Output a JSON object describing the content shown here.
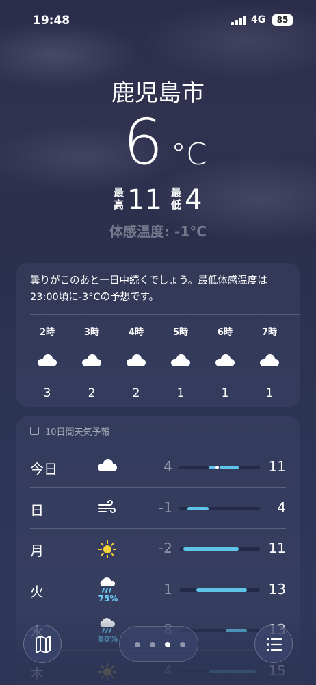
{
  "status": {
    "time": "19:48",
    "network": "4G",
    "battery": "85"
  },
  "location": {
    "city": "鹿児島市"
  },
  "current": {
    "temp": "6",
    "unit": "°C",
    "high_label": "最高",
    "high": "11",
    "low_label": "最低",
    "low": "4",
    "feels_like": "体感温度: -1°C"
  },
  "summary": "曇りがこのあと一日中続くでしょう。最低体感温度は23:00頃に-3°Cの予想です。",
  "hourly": [
    {
      "label": "2時",
      "icon": "cloud-icon",
      "value": "3"
    },
    {
      "label": "3時",
      "icon": "cloud-icon",
      "value": "2"
    },
    {
      "label": "4時",
      "icon": "cloud-icon",
      "value": "2"
    },
    {
      "label": "5時",
      "icon": "cloud-icon",
      "value": "1"
    },
    {
      "label": "6時",
      "icon": "cloud-icon",
      "value": "1"
    },
    {
      "label": "7時",
      "icon": "cloud-icon",
      "value": "1"
    }
  ],
  "forecast": {
    "title": "10日間天気予報",
    "range": {
      "min": -3,
      "max": 16
    },
    "current_temp": 6,
    "days": [
      {
        "day": "今日",
        "icon": "cloud-icon",
        "precip": "",
        "low": "4",
        "high": "11",
        "low_val": 4,
        "high_val": 11
      },
      {
        "day": "日",
        "icon": "wind-icon",
        "precip": "",
        "low": "-1",
        "high": "4",
        "low_val": -1,
        "high_val": 4
      },
      {
        "day": "月",
        "icon": "sun-icon",
        "precip": "",
        "low": "-2",
        "high": "11",
        "low_val": -2,
        "high_val": 11
      },
      {
        "day": "火",
        "icon": "rain-cloud-icon",
        "precip": "75%",
        "low": "1",
        "high": "13",
        "low_val": 1,
        "high_val": 13
      },
      {
        "day": "水",
        "icon": "rain-cloud-icon",
        "precip": "80%",
        "low": "8",
        "high": "13",
        "low_val": 8,
        "high_val": 13
      },
      {
        "day": "木",
        "icon": "sun-icon",
        "precip": "",
        "low": "4",
        "high": "15",
        "low_val": 4,
        "high_val": 15
      }
    ]
  },
  "nav": {
    "pages": 4,
    "active_page": 3,
    "left_icon": "map-icon",
    "right_icon": "list-icon"
  },
  "colors": {
    "accent": "#5ec4ea",
    "precip": "#6ccdf5",
    "sun": "#f5d13a"
  }
}
